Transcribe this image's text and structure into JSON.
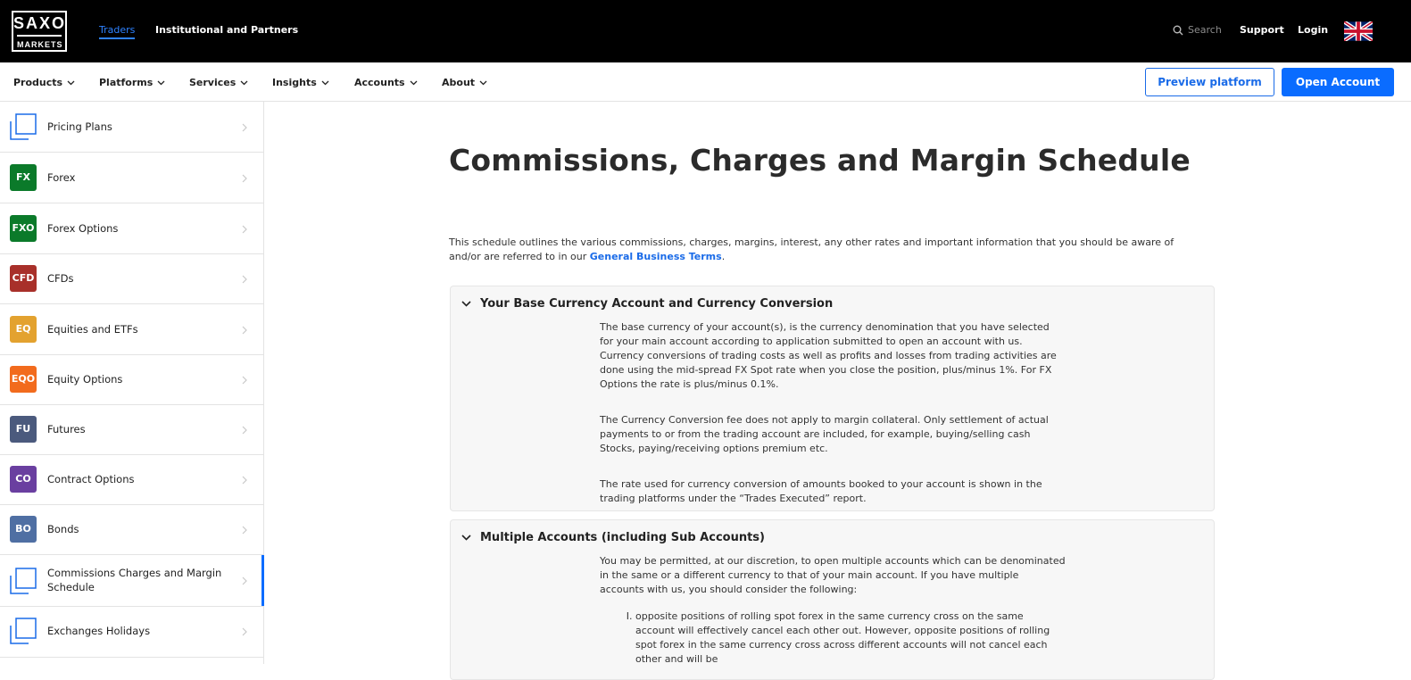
{
  "header": {
    "logo_top": "SAXO",
    "logo_bottom": "MARKETS",
    "links": [
      "Traders",
      "Institutional and Partners"
    ],
    "search_label": "Search",
    "support_label": "Support",
    "login_label": "Login",
    "flag_icon": "uk-flag-icon"
  },
  "nav": {
    "items": [
      "Products",
      "Platforms",
      "Services",
      "Insights",
      "Accounts",
      "About"
    ],
    "preview_label": "Preview platform",
    "open_label": "Open Account"
  },
  "sidebar": {
    "items": [
      {
        "badge": "",
        "label": "Pricing Plans"
      },
      {
        "badge": "FX",
        "label": "Forex",
        "color": "#0b7a2a"
      },
      {
        "badge": "FXO",
        "label": "Forex Options",
        "color": "#0b7a2a"
      },
      {
        "badge": "CFD",
        "label": "CFDs",
        "color": "#a8302a"
      },
      {
        "badge": "EQ",
        "label": "Equities and ETFs",
        "color": "#e3a22f"
      },
      {
        "badge": "EQO",
        "label": "Equity Options",
        "color": "#f26b1d"
      },
      {
        "badge": "FU",
        "label": "Futures",
        "color": "#4b5a7d"
      },
      {
        "badge": "CO",
        "label": "Contract Options",
        "color": "#6a3fa0"
      },
      {
        "badge": "BO",
        "label": "Bonds",
        "color": "#4f6fa3"
      },
      {
        "badge": "",
        "label": "Commissions Charges and Margin Schedule"
      },
      {
        "badge": "",
        "label": "Exchanges Holidays"
      }
    ]
  },
  "main": {
    "title": "Commissions, Charges and Margin Schedule",
    "intro_text": "This schedule outlines the various commissions, charges, margins, interest, any other rates and important information that you should be aware of and/or are referred to in our ",
    "intro_link": "General Business Terms",
    "intro_end": ".",
    "sections": [
      {
        "title": "Your Base Currency Account and Currency Conversion",
        "paragraphs": [
          "The base currency of your account(s), is the currency denomination that you have selected for your main account according to application submitted to open an account with us. Currency conversions of trading costs as well as profits and losses from trading activities are done using the mid-spread FX Spot rate when you close the position, plus/minus 1%. For FX Options the rate is plus/minus 0.1%.",
          "The Currency Conversion fee does not apply to margin collateral. Only settlement of actual payments to or from the trading account are included, for example, buying/selling cash Stocks, paying/receiving options premium etc.",
          "The rate used for currency conversion of amounts booked to your account is shown in the trading platforms under the “Trades Executed” report."
        ]
      },
      {
        "title": "Multiple Accounts (including Sub Accounts)",
        "paragraphs": [
          "You may be permitted, at our discretion, to open multiple accounts which can be denominated in the same or a different currency to that of your main account. If you have multiple accounts with us, you should consider the following:"
        ],
        "list": [
          "opposite positions of rolling spot forex in the same currency cross on the same account will effectively cancel each other out. However, opposite positions of rolling spot forex in the same currency cross across different accounts will not cancel each other and will be"
        ]
      }
    ]
  }
}
